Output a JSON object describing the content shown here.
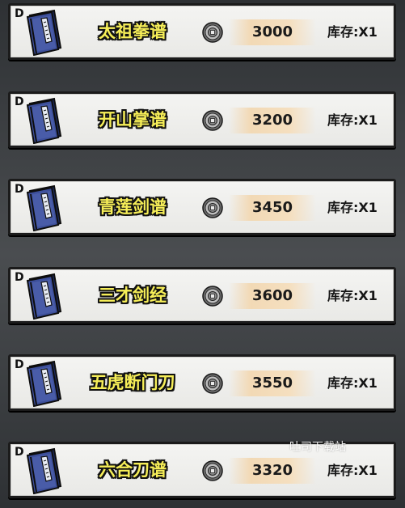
{
  "shop": {
    "items": [
      {
        "grade": "D",
        "name": "太祖拳谱",
        "price": "3000",
        "stock": "库存:X1",
        "icon": "manual-book-icon",
        "currency_icon": "silver-coin-icon"
      },
      {
        "grade": "D",
        "name": "开山掌谱",
        "price": "3200",
        "stock": "库存:X1",
        "icon": "manual-book-icon",
        "currency_icon": "silver-coin-icon"
      },
      {
        "grade": "D",
        "name": "青莲剑谱",
        "price": "3450",
        "stock": "库存:X1",
        "icon": "manual-book-icon",
        "currency_icon": "silver-coin-icon"
      },
      {
        "grade": "D",
        "name": "三才剑经",
        "price": "3600",
        "stock": "库存:X1",
        "icon": "manual-book-icon",
        "currency_icon": "silver-coin-icon"
      },
      {
        "grade": "D",
        "name": "五虎断门刀",
        "price": "3550",
        "stock": "库存:X1",
        "icon": "manual-book-icon",
        "currency_icon": "silver-coin-icon"
      },
      {
        "grade": "D",
        "name": "六合刀谱",
        "price": "3320",
        "stock": "库存:X1",
        "icon": "manual-book-icon",
        "currency_icon": "silver-coin-icon"
      }
    ]
  },
  "watermark": "吐司下载站",
  "colors": {
    "name_text": "#f6ee58",
    "row_bg": "#f0f0ee",
    "price_bar": "#f4dcba",
    "book_blue": "#3d4f9a"
  }
}
